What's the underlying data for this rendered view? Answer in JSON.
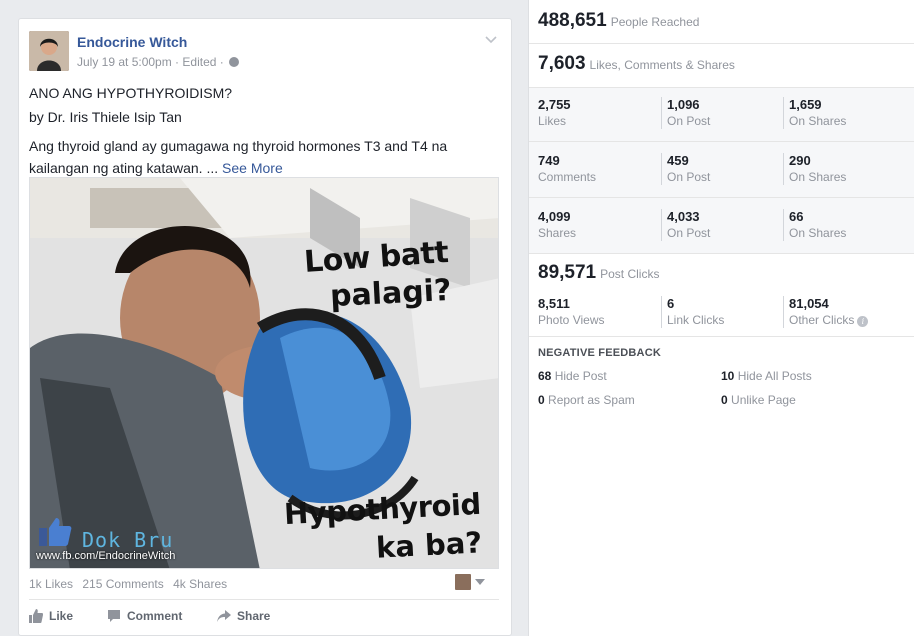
{
  "post": {
    "author": "Endocrine Witch",
    "meta": "July 19 at 5:00pm · Edited ·",
    "title_line": "ANO ANG HYPOTHYROIDISM?",
    "byline": "by Dr. Iris Thiele Isip Tan",
    "body": "Ang thyroid gland ay gumagawa ng thyroid hormones T3 and T4 na kailangan ng ating katawan. ...",
    "see_more": "See More",
    "image_caption_1": "Low batt",
    "image_caption_2": "palagi?",
    "image_caption_3": "Hypothyroid",
    "image_caption_4": "ka ba?",
    "watermark_brand": "Dok Bru",
    "watermark_site": "www.fb.com/EndocrineWitch",
    "counts": {
      "likes": "1k Likes",
      "comments": "215 Comments",
      "shares": "4k Shares"
    },
    "actions": {
      "like": "Like",
      "comment": "Comment",
      "share": "Share"
    }
  },
  "insights": {
    "reach": {
      "value": "488,651",
      "label": "People Reached"
    },
    "engagement": {
      "value": "7,603",
      "label": "Likes, Comments & Shares"
    },
    "rows": [
      [
        {
          "n": "2,755",
          "l": "Likes"
        },
        {
          "n": "1,096",
          "l": "On Post"
        },
        {
          "n": "1,659",
          "l": "On Shares"
        }
      ],
      [
        {
          "n": "749",
          "l": "Comments"
        },
        {
          "n": "459",
          "l": "On Post"
        },
        {
          "n": "290",
          "l": "On Shares"
        }
      ],
      [
        {
          "n": "4,099",
          "l": "Shares"
        },
        {
          "n": "4,033",
          "l": "On Post"
        },
        {
          "n": "66",
          "l": "On Shares"
        }
      ]
    ],
    "clicks": {
      "value": "89,571",
      "label": "Post Clicks",
      "items": [
        {
          "n": "8,511",
          "l": "Photo Views"
        },
        {
          "n": "6",
          "l": "Link Clicks"
        },
        {
          "n": "81,054",
          "l": "Other Clicks"
        }
      ]
    },
    "negative": {
      "title": "NEGATIVE FEEDBACK",
      "items": [
        {
          "n": "68",
          "l": "Hide Post"
        },
        {
          "n": "10",
          "l": "Hide All Posts"
        },
        {
          "n": "0",
          "l": "Report as Spam"
        },
        {
          "n": "0",
          "l": "Unlike Page"
        }
      ]
    },
    "info_glyph": "i"
  },
  "colors": {
    "link": "#365899",
    "muted": "#90949c",
    "text": "#1d2129",
    "panel_grey": "#f6f7f9"
  }
}
